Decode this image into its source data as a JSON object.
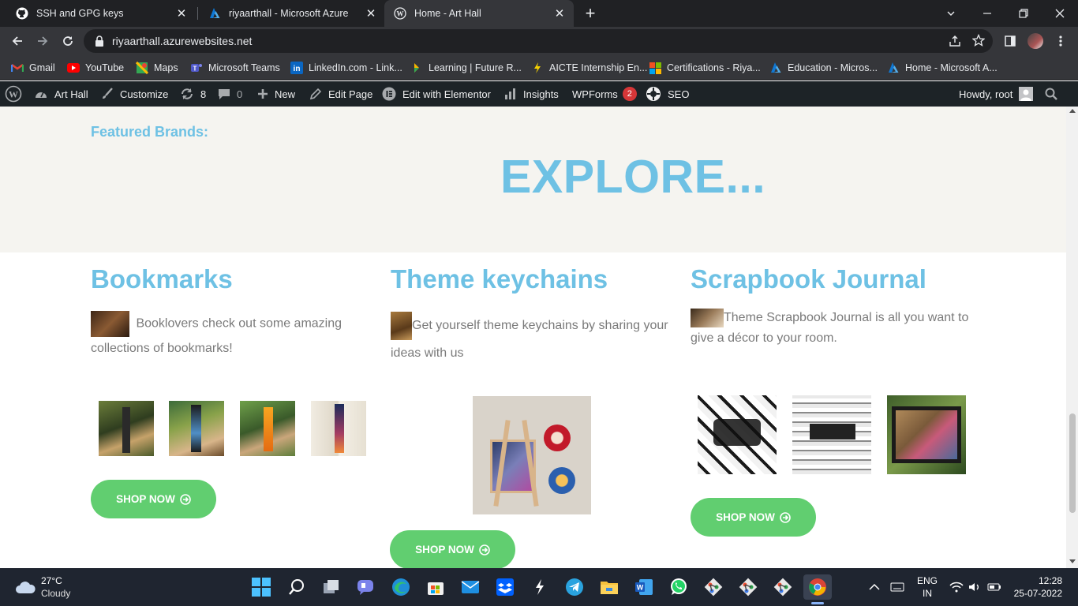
{
  "browser": {
    "tabs": [
      {
        "title": "SSH and GPG keys",
        "icon": "github-icon"
      },
      {
        "title": "riyaarthall - Microsoft Azure",
        "icon": "azure-icon"
      },
      {
        "title": "Home - Art Hall",
        "icon": "wordpress-icon",
        "active": true
      }
    ],
    "url": "riyaarthall.azurewebsites.net",
    "bookmarks": [
      {
        "label": "Gmail",
        "icon": "gmail-icon"
      },
      {
        "label": "YouTube",
        "icon": "youtube-icon"
      },
      {
        "label": "Maps",
        "icon": "maps-icon"
      },
      {
        "label": "Microsoft Teams",
        "icon": "teams-icon"
      },
      {
        "label": "LinkedIn.com - Link...",
        "icon": "linkedin-icon"
      },
      {
        "label": "Learning | Future R...",
        "icon": "futureready-icon"
      },
      {
        "label": "AICTE Internship En...",
        "icon": "aicte-icon"
      },
      {
        "label": "Certifications - Riya...",
        "icon": "microsoft-icon"
      },
      {
        "label": "Education - Micros...",
        "icon": "azure-icon"
      },
      {
        "label": "Home - Microsoft A...",
        "icon": "azure-icon"
      }
    ]
  },
  "wpbar": {
    "site": "Art Hall",
    "customize": "Customize",
    "updates": "8",
    "comments": "0",
    "new": "New",
    "edit_page": "Edit Page",
    "elementor": "Edit with Elementor",
    "insights": "Insights",
    "wpforms": "WPForms",
    "wpforms_badge": "2",
    "seo": "SEO",
    "howdy": "Howdy, root"
  },
  "page": {
    "featured": "Featured Brands:",
    "explore": "EXPLORE...",
    "columns": [
      {
        "title": "Bookmarks",
        "desc": " Booklovers check out some amazing collections of bookmarks!",
        "button": "SHOP NOW"
      },
      {
        "title": "Theme keychains",
        "desc": "Get yourself theme keychains by sharing your ideas with us",
        "button": "SHOP NOW"
      },
      {
        "title": "Scrapbook Journal",
        "desc": "Theme Scrapbook Journal is all you want to give a décor  to your room.",
        "button": "SHOP NOW"
      }
    ]
  },
  "taskbar": {
    "temp": "27°C",
    "weather": "Cloudy",
    "lang1": "ENG",
    "lang2": "IN",
    "time": "12:28",
    "date": "25-07-2022"
  },
  "colors": {
    "accent": "#6ec1e4",
    "button": "#61ce70",
    "text": "#7a7a7a"
  }
}
